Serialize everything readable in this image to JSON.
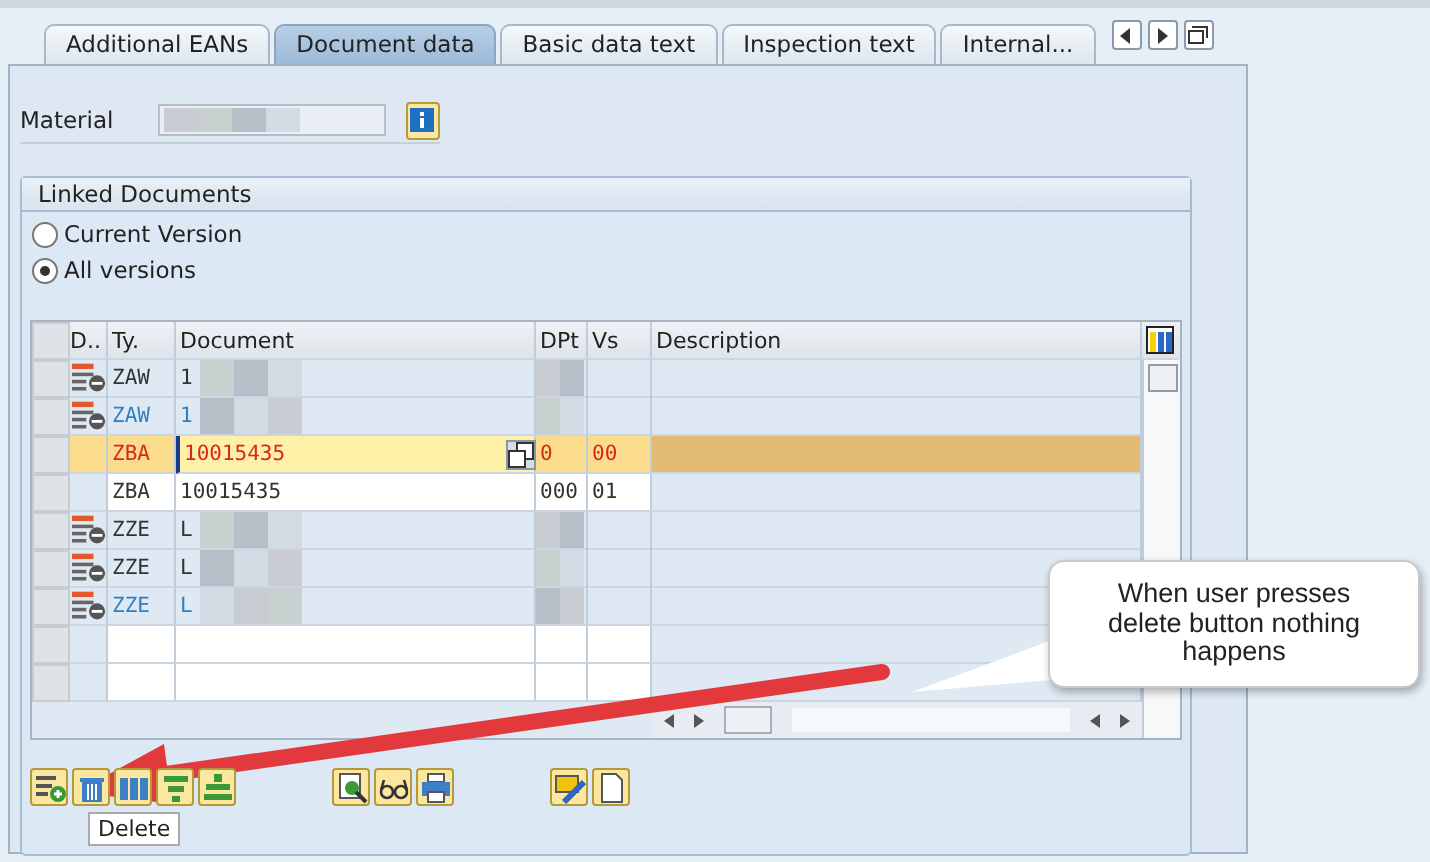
{
  "tabs": [
    {
      "label": "Additional EANs",
      "selected": false
    },
    {
      "label": "Document data",
      "selected": true
    },
    {
      "label": "Basic data text",
      "selected": false
    },
    {
      "label": "Inspection text",
      "selected": false
    },
    {
      "label": "Internal...",
      "selected": false
    }
  ],
  "material": {
    "label": "Material",
    "redacted": true
  },
  "group": {
    "title": "Linked Documents",
    "options": [
      {
        "label": "Current Version",
        "selected": false
      },
      {
        "label": "All versions",
        "selected": true
      }
    ]
  },
  "table": {
    "columns": [
      "D..",
      "Ty.",
      "Document",
      "DPt",
      "Vs",
      "Description"
    ],
    "rows": [
      {
        "kind": "linked",
        "selected": false,
        "emphasized": false,
        "type": "ZAW",
        "document": "1",
        "dpt": "",
        "vs": "",
        "redacted": true
      },
      {
        "kind": "linked",
        "selected": false,
        "emphasized": true,
        "type": "ZAW",
        "document": "1",
        "dpt": "",
        "vs": "",
        "redacted": true
      },
      {
        "kind": "plain",
        "selected": true,
        "emphasized": false,
        "type": "ZBA",
        "document": "10015435",
        "dpt": "0",
        "vs": "00",
        "redacted": false
      },
      {
        "kind": "entry",
        "selected": false,
        "emphasized": false,
        "type": "ZBA",
        "document": "10015435",
        "dpt": "000",
        "vs": "01",
        "redacted": false
      },
      {
        "kind": "linked",
        "selected": false,
        "emphasized": false,
        "type": "ZZE",
        "document": "L",
        "dpt": "",
        "vs": "",
        "redacted": true
      },
      {
        "kind": "linked",
        "selected": false,
        "emphasized": false,
        "type": "ZZE",
        "document": "L",
        "dpt": "",
        "vs": "",
        "redacted": true
      },
      {
        "kind": "linked",
        "selected": false,
        "emphasized": true,
        "type": "ZZE",
        "document": "L",
        "dpt": "",
        "vs": "",
        "redacted": true
      },
      {
        "kind": "empty",
        "selected": false
      },
      {
        "kind": "empty",
        "selected": false
      }
    ]
  },
  "toolbar": [
    {
      "kind": "add"
    },
    {
      "kind": "delete"
    },
    {
      "kind": "columns"
    },
    {
      "kind": "filter"
    },
    {
      "kind": "sort"
    },
    {
      "kind": "gap"
    },
    {
      "kind": "find"
    },
    {
      "kind": "glasses"
    },
    {
      "kind": "print"
    },
    {
      "kind": "gap"
    },
    {
      "kind": "edit"
    },
    {
      "kind": "page"
    }
  ],
  "tooltip": "Delete",
  "callout": "When user presses delete button nothing happens"
}
